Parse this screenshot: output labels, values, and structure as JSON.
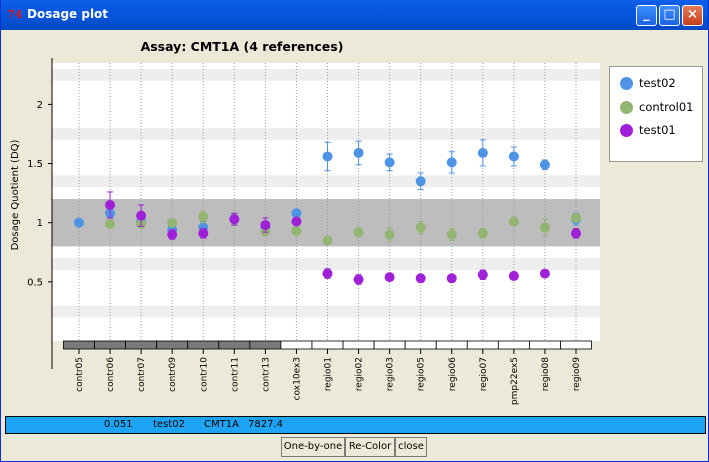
{
  "window": {
    "title": "Dosage plot",
    "app_icon": "java-duke-icon",
    "app_icon_glyph": "74"
  },
  "chart_data": {
    "type": "scatter",
    "title": "Assay: CMT1A (4 references)",
    "xlabel": "",
    "ylabel": "Dosage Quotient (DQ)",
    "yticks": [
      0.5,
      1,
      1.5,
      2
    ],
    "ytick_labels": [
      "0.5",
      "1",
      "1.5",
      "2"
    ],
    "ylim": [
      0.0,
      2.35
    ],
    "reference_band": [
      0.8,
      1.2
    ],
    "categories": [
      "contr05",
      "contr06",
      "contr07",
      "contr09",
      "contr10",
      "contr11",
      "contr13",
      "cox10ex3",
      "regio01",
      "regio02",
      "regio03",
      "regio05",
      "regio06",
      "regio07",
      "pmp22ex5",
      "regio08",
      "regio09"
    ],
    "category_bar_filled": [
      true,
      true,
      true,
      true,
      true,
      true,
      true,
      false,
      false,
      false,
      false,
      false,
      false,
      false,
      false,
      false,
      false
    ],
    "legend_position": "top-right",
    "series": [
      {
        "name": "test02",
        "color": "#4f94e4",
        "values": [
          1.0,
          1.08,
          1.01,
          0.94,
          0.96,
          1.03,
          0.96,
          1.08,
          1.56,
          1.59,
          1.51,
          1.35,
          1.51,
          1.59,
          1.56,
          1.49,
          1.03
        ],
        "errors": [
          0.0,
          0.04,
          0.04,
          0.04,
          0.05,
          0.05,
          0.04,
          0.03,
          0.12,
          0.1,
          0.07,
          0.07,
          0.09,
          0.11,
          0.08,
          0.04,
          0.05
        ]
      },
      {
        "name": "control01",
        "color": "#93b572",
        "values": [
          null,
          0.99,
          0.99,
          1.0,
          1.05,
          1.03,
          0.93,
          0.93,
          0.85,
          0.92,
          0.9,
          0.96,
          0.9,
          0.91,
          1.01,
          0.96,
          1.04
        ],
        "errors": [
          0.0,
          0.02,
          0.03,
          0.02,
          0.05,
          0.04,
          0.04,
          0.02,
          0.03,
          0.03,
          0.06,
          0.05,
          0.05,
          0.04,
          0.03,
          0.07,
          0.02
        ]
      },
      {
        "name": "test01",
        "color": "#a020d8",
        "values": [
          null,
          1.15,
          1.06,
          0.9,
          0.91,
          1.03,
          0.98,
          1.01,
          0.57,
          0.52,
          0.54,
          0.53,
          0.53,
          0.56,
          0.55,
          0.57,
          0.91
        ],
        "errors": [
          0.0,
          0.11,
          0.09,
          0.04,
          0.04,
          0.05,
          0.06,
          0.03,
          0.04,
          0.04,
          0.02,
          0.03,
          0.02,
          0.04,
          0.03,
          0.02,
          0.04
        ]
      }
    ]
  },
  "status": {
    "dq": "0.051",
    "sample": "test02",
    "assay": "CMT1A",
    "value": "7827.4"
  },
  "buttons": {
    "one_by_one": "One-by-one",
    "recolor": "Re-Color",
    "close": "close"
  }
}
